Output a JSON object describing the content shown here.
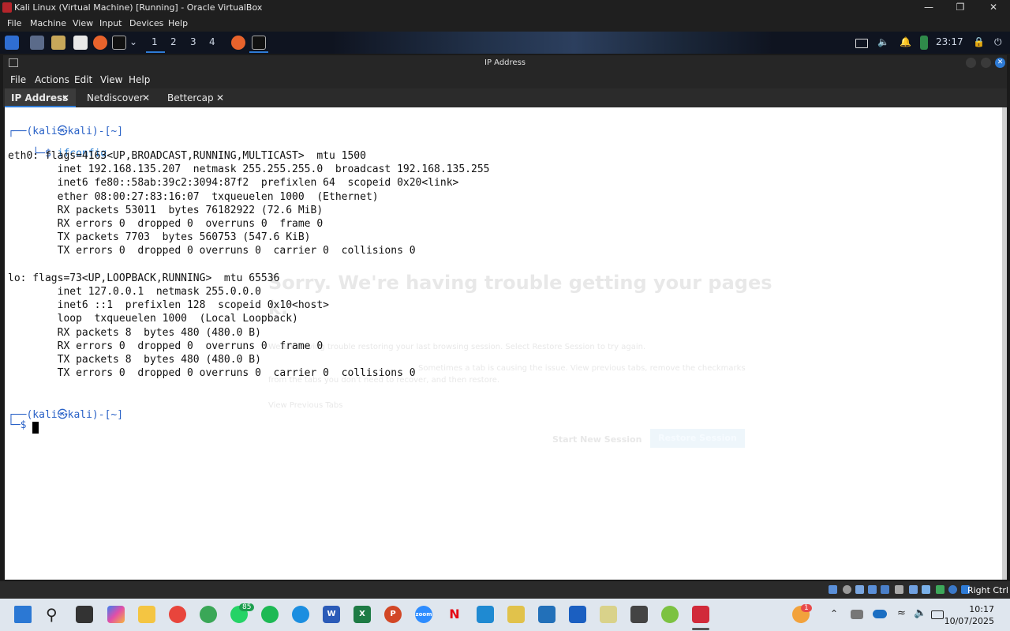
{
  "vbox": {
    "title": "Kali Linux (Virtual Machine) [Running] - Oracle VirtualBox",
    "menu": [
      "File",
      "Machine",
      "View",
      "Input",
      "Devices",
      "Help"
    ],
    "status_right": "Right Ctrl"
  },
  "kali_panel": {
    "workspaces": [
      "1",
      "2",
      "3",
      "4"
    ],
    "time": "23:17"
  },
  "terminal": {
    "title": "IP Address",
    "menu": [
      "File",
      "Actions",
      "Edit",
      "View",
      "Help"
    ],
    "tabs": [
      {
        "label": "IP Address",
        "active": true
      },
      {
        "label": "Netdiscover",
        "active": false
      },
      {
        "label": "Bettercap",
        "active": false
      }
    ],
    "prompt_top": "┌──(kali㉿kali)-[~]",
    "prompt_bottom": "└─$",
    "command": "ifconfig",
    "output": [
      "eth0: flags=4163<UP,BROADCAST,RUNNING,MULTICAST>  mtu 1500",
      "        inet 192.168.135.207  netmask 255.255.255.0  broadcast 192.168.135.255",
      "        inet6 fe80::58ab:39c2:3094:87f2  prefixlen 64  scopeid 0x20<link>",
      "        ether 08:00:27:83:16:07  txqueuelen 1000  (Ethernet)",
      "        RX packets 53011  bytes 76182922 (72.6 MiB)",
      "        RX errors 0  dropped 0  overruns 0  frame 0",
      "        TX packets 7703  bytes 560753 (547.6 KiB)",
      "        TX errors 0  dropped 0 overruns 0  carrier 0  collisions 0",
      "",
      "lo: flags=73<UP,LOOPBACK,RUNNING>  mtu 65536",
      "        inet 127.0.0.1  netmask 255.0.0.0",
      "        inet6 ::1  prefixlen 128  scopeid 0x10<host>",
      "        loop  txqueuelen 1000  (Local Loopback)",
      "        RX packets 8  bytes 480 (480.0 B)",
      "        RX errors 0  dropped 0  overruns 0  frame 0",
      "        TX packets 8  bytes 480 (480.0 B)",
      "        TX errors 0  dropped 0 overruns 0  carrier 0  collisions 0"
    ],
    "background_ghost": {
      "heading": "Sorry. We're having trouble getting your pages",
      "heading2": "k.",
      "line1": "We are having trouble restoring your last browsing session. Select Restore Session to try again.",
      "line2": "Sometimes a tab is causing the issue. View previous tabs, remove the checkmarks",
      "line3": "from the tabs you don't need to recover, and then restore.",
      "view_tabs": "View Previous Tabs",
      "start_new": "Start New Session",
      "restore": "Restore Session"
    }
  },
  "taskbar": {
    "whatsapp_badge": "85",
    "notif_badge": "1",
    "time": "10:17",
    "date": "10/07/2025"
  }
}
